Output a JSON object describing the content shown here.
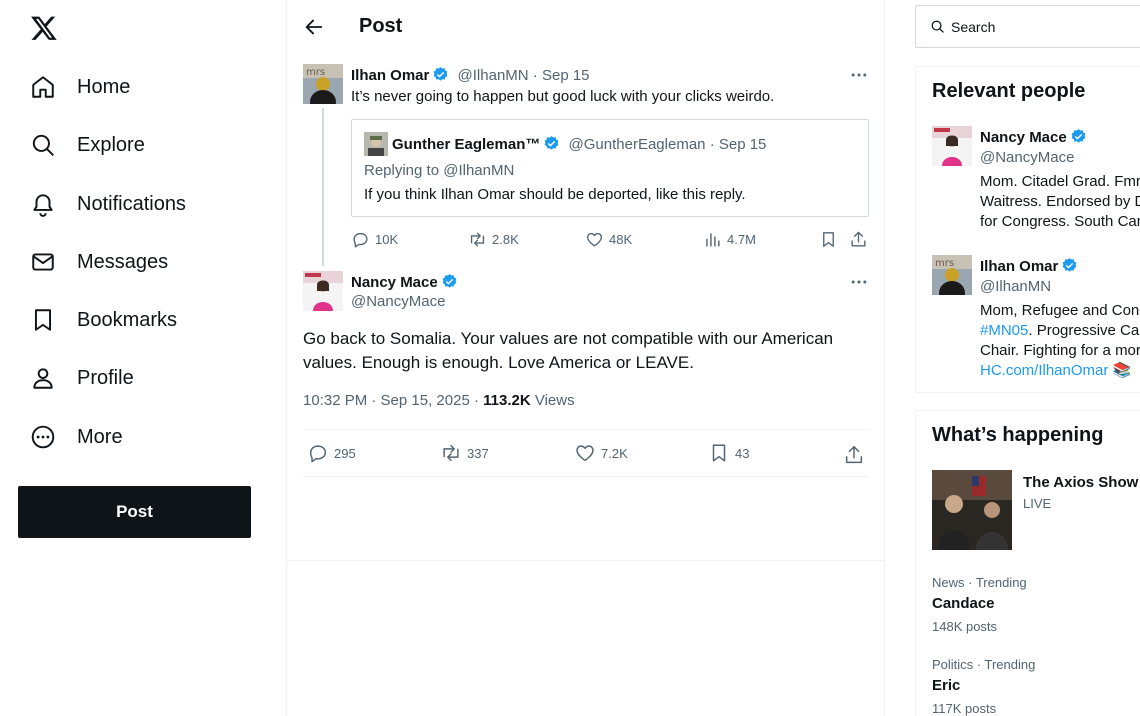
{
  "nav": {
    "items": [
      {
        "label": "Home",
        "icon": "home-icon"
      },
      {
        "label": "Explore",
        "icon": "search-icon"
      },
      {
        "label": "Notifications",
        "icon": "bell-icon"
      },
      {
        "label": "Messages",
        "icon": "envelope-icon"
      },
      {
        "label": "Bookmarks",
        "icon": "bookmark-icon"
      },
      {
        "label": "Profile",
        "icon": "person-icon"
      },
      {
        "label": "More",
        "icon": "more-circle-icon"
      }
    ],
    "post_button": "Post"
  },
  "header": {
    "title": "Post"
  },
  "parent_tweet": {
    "name": "Ilhan Omar",
    "handle": "@IlhanMN",
    "date": "Sep 15",
    "text": "It’s never going to happen but good luck with your clicks weirdo.",
    "quote": {
      "name": "Gunther Eagleman™",
      "handle": "@GuntherEagleman",
      "date": "Sep 15",
      "replying_to": "Replying to @IlhanMN",
      "text": "If you think Ilhan Omar should be deported, like this reply."
    },
    "stats": {
      "replies": "10K",
      "reposts": "2.8K",
      "likes": "48K",
      "views": "4.7M"
    }
  },
  "main_tweet": {
    "name": "Nancy Mace",
    "handle": "@NancyMace",
    "text": "Go back to Somalia. Your values are not compatible with our American values. Enough is enough. Love America or LEAVE.",
    "timestamp": "10:32 PM · Sep 15, 2025",
    "views_count": "113.2K",
    "views_label": "Views",
    "stats": {
      "replies": "295",
      "reposts": "337",
      "likes": "7.2K",
      "bookmarks": "43"
    }
  },
  "search": {
    "placeholder": "Search"
  },
  "relevant_people": {
    "title": "Relevant people",
    "people": [
      {
        "name": "Nancy Mace",
        "handle": "@NancyMace",
        "bio_lines": [
          "Mom. Citadel Grad. Fmr",
          "Waitress. Endorsed by D",
          "for Congress. South Caro"
        ]
      },
      {
        "name": "Ilhan Omar",
        "handle": "@IlhanMN",
        "bio_line1": "Mom, Refugee and Cong",
        "bio_hashtag": "#MN05",
        "bio_line2_rest": ". Progressive Cau",
        "bio_line3": "Chair. Fighting for a mor",
        "bio_link": "HC.com/IlhanOmar",
        "bio_emoji": "📚"
      }
    ]
  },
  "whats_happening": {
    "title": "What’s happening",
    "featured": {
      "title": "The Axios Show",
      "subtitle": "LIVE"
    },
    "trends": [
      {
        "meta": "News · Trending",
        "name": "Candace",
        "count": "148K posts"
      },
      {
        "meta": "Politics · Trending",
        "name": "Eric",
        "count": "117K posts"
      }
    ]
  },
  "colors": {
    "accent": "#1d9bf0",
    "text": "#0f1419",
    "muted": "#536471",
    "border": "#cfd9de"
  }
}
